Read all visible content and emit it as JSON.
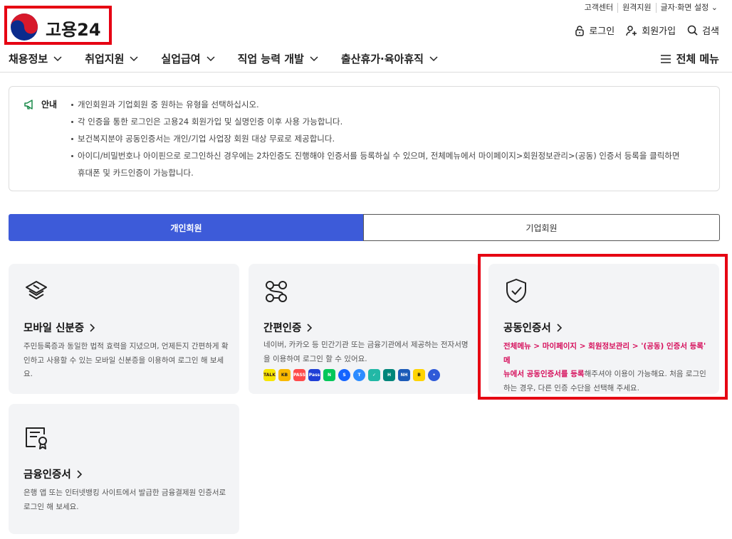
{
  "header": {
    "logo_text": "고용24",
    "util_links": [
      "고객센터",
      "원격지원",
      "글자·화면 설정"
    ],
    "actions": {
      "login": "로그인",
      "signup": "회원가입",
      "search": "검색"
    },
    "nav": [
      "채용정보",
      "취업지원",
      "실업급여",
      "직업 능력 개발",
      "출산휴가·육아휴직"
    ],
    "all_menu": "전체 메뉴"
  },
  "notice": {
    "title": "안내",
    "items": [
      "개인회원과 기업회원 중 원하는 유형을 선택하십시오.",
      "각 인증을 통한 로그인은 고용24 회원가입 및 실명인증 이후 사용 가능합니다.",
      "보건복지분야 공동인증서는 개인/기업 사업장 회원 대상 무료로 제공합니다.",
      "아이디/비밀번호나 아이핀으로 로그인하신 경우에는 2차인증도 진행해야 인증서를 등록하실 수 있으며, 전체메뉴에서 마이페이지>회원정보관리>(공동) 인증서 등록을 클릭하면",
      "휴대폰 및 카드인증이 가능합니다."
    ]
  },
  "tabs": {
    "personal": "개인회원",
    "corporate": "기업회원"
  },
  "cards": {
    "mobile_id": {
      "title": "모바일 신분증",
      "desc_line1": "주민등록증과 동일한 법적 효력을 지녔으며, 언제든지 간편하게 확",
      "desc_line2": "인하고 사용할 수 있는 모바일 신분증을 이용하여 로그인 해 보세",
      "desc_line3": "요."
    },
    "simple_auth": {
      "title": "간편인증",
      "desc_line1": "네이버, 카카오 등 민간기관 또는 금융기관에서 제공하는 전자서명",
      "desc_line2": "을 이용하여 로그인 할 수 있어요.",
      "badges": [
        {
          "label": "TALK",
          "color": "#f7e600",
          "fg": "#3a1d1d"
        },
        {
          "label": "KB",
          "color": "#f9b800",
          "fg": "#222"
        },
        {
          "label": "PASS",
          "color": "#ff4b4b",
          "fg": "#fff"
        },
        {
          "label": "Pass",
          "color": "#1f3fd6",
          "fg": "#fff"
        },
        {
          "label": "N",
          "color": "#03c75a",
          "fg": "#fff"
        },
        {
          "label": "S",
          "color": "#1464ff",
          "fg": "#fff"
        },
        {
          "label": "T",
          "color": "#2d8cff",
          "fg": "#fff"
        },
        {
          "label": "✓",
          "color": "#22b8a6",
          "fg": "#fff"
        },
        {
          "label": "H",
          "color": "#00857a",
          "fg": "#fff"
        },
        {
          "label": "NH",
          "color": "#1c5bb8",
          "fg": "#fff"
        },
        {
          "label": "B",
          "color": "#ffd400",
          "fg": "#111"
        },
        {
          "label": "•",
          "color": "#2f5ad8",
          "fg": "#fff"
        }
      ]
    },
    "joint_cert": {
      "title": "공동인증서",
      "desc_hl1": "전체메뉴 > 마이페이지 > 회원정보관리 > '(공동) 인증서 등록' 메",
      "desc_hl2": "뉴에서 공동인증서를 등록",
      "desc_rest2": "해주셔야 이용이 가능해요. 처음 로그인",
      "desc_line3": "하는 경우, 다른 인증 수단을 선택해 주세요."
    },
    "financial_cert": {
      "title": "금융인증서",
      "desc_line1": "은행 앱 또는 인터넷뱅킹 사이트에서 발급한 금융결제원 인증서로",
      "desc_line2": "로그인 해 보세요."
    }
  },
  "colors": {
    "accent": "#3d5bd9",
    "highlight": "#d6105c",
    "annotation": "#e60012"
  },
  "icons": [
    "taegeuk-logo-icon",
    "lock-icon",
    "user-plus-icon",
    "search-icon",
    "chevron-down-icon",
    "hamburger-icon",
    "megaphone-icon",
    "layers-icon",
    "nodes-icon",
    "shield-check-icon",
    "certificate-icon",
    "chevron-right-icon"
  ]
}
